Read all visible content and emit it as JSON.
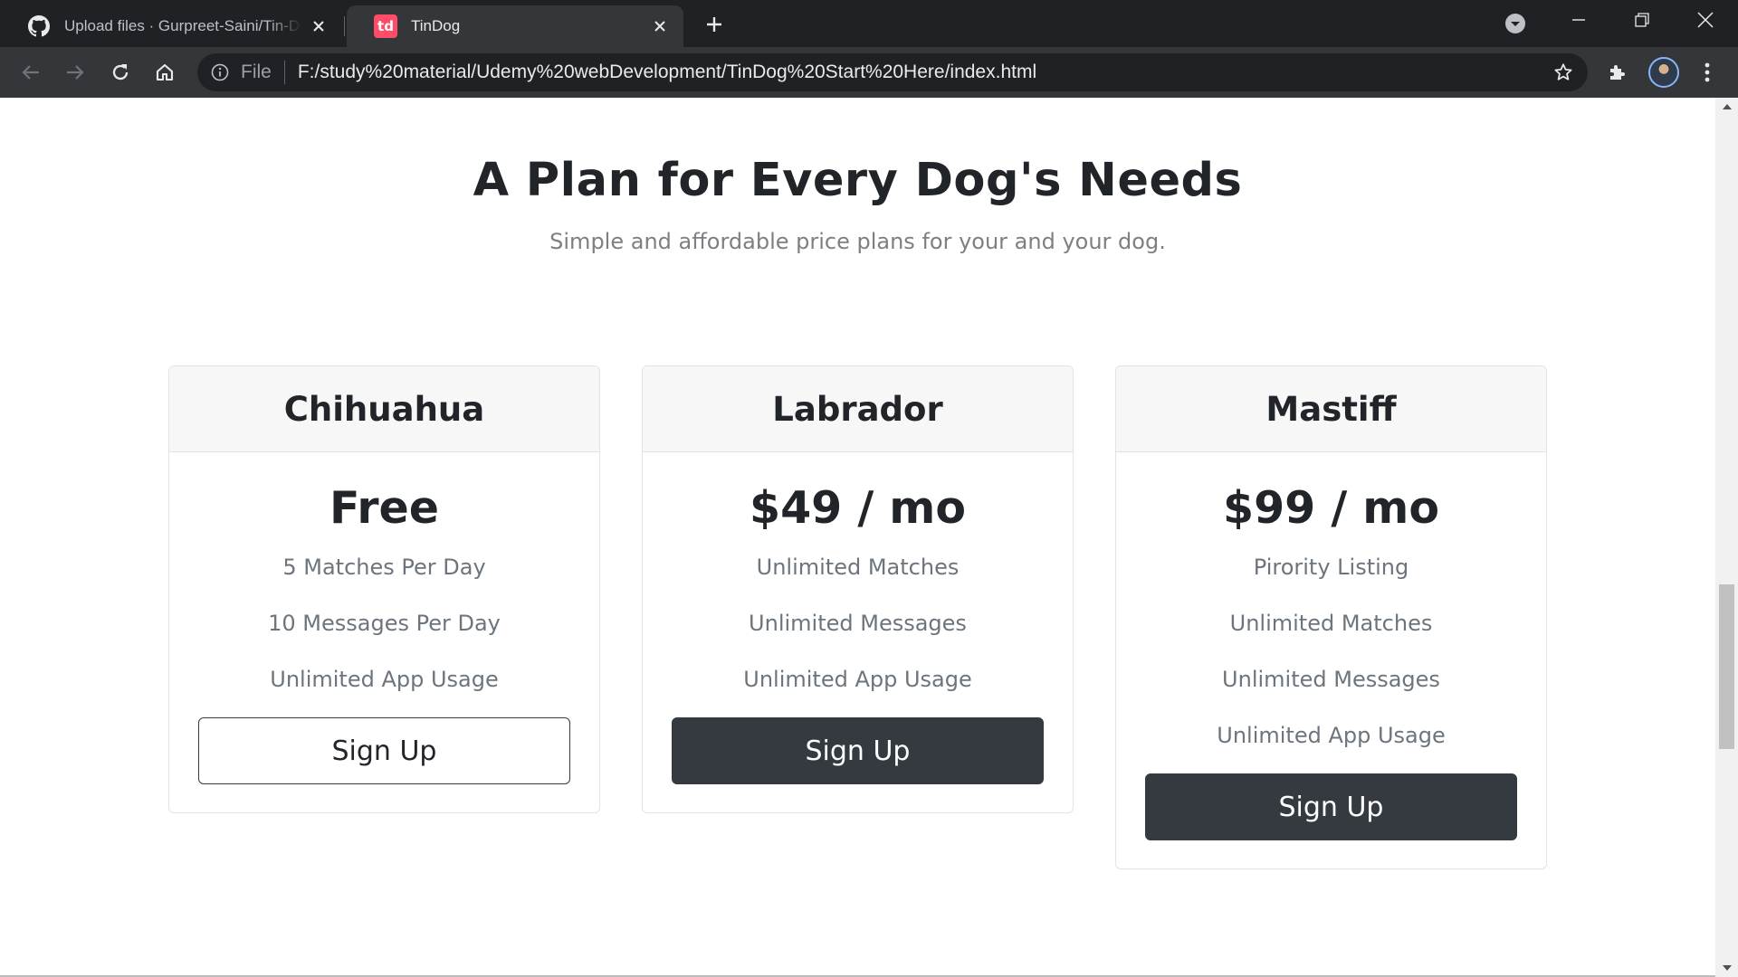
{
  "browser": {
    "tabs": [
      {
        "title": "Upload files · Gurpreet-Saini/Tin-Dog",
        "icon": "github-icon",
        "active": false
      },
      {
        "title": "TinDog",
        "icon": "tindog-favicon",
        "favicon_text": "td",
        "active": true
      }
    ],
    "address": {
      "chip": "File",
      "url": "F:/study%20material/Udemy%20webDevelopment/TinDog%20Start%20Here/index.html"
    }
  },
  "pricing": {
    "title": "A Plan for Every Dog's Needs",
    "subtitle": "Simple and affordable price plans for your and your dog.",
    "plans": [
      {
        "name": "Chihuahua",
        "price": "Free",
        "features": [
          "5 Matches Per Day",
          "10 Messages Per Day",
          "Unlimited App Usage"
        ],
        "button": "Sign Up",
        "button_style": "outline"
      },
      {
        "name": "Labrador",
        "price": "$49 / mo",
        "features": [
          "Unlimited Matches",
          "Unlimited Messages",
          "Unlimited App Usage"
        ],
        "button": "Sign Up",
        "button_style": "dark"
      },
      {
        "name": "Mastiff",
        "price": "$99 / mo",
        "features": [
          "Pirority Listing",
          "Unlimited Matches",
          "Unlimited Messages",
          "Unlimited App Usage"
        ],
        "button": "Sign Up",
        "button_style": "dark"
      }
    ]
  },
  "colors": {
    "chrome_dark": "#202124",
    "chrome_toolbar": "#35363a",
    "tindog_red": "#ff4c68",
    "button_dark": "#343a40",
    "heading": "#212529",
    "muted_text": "#6c757d"
  }
}
